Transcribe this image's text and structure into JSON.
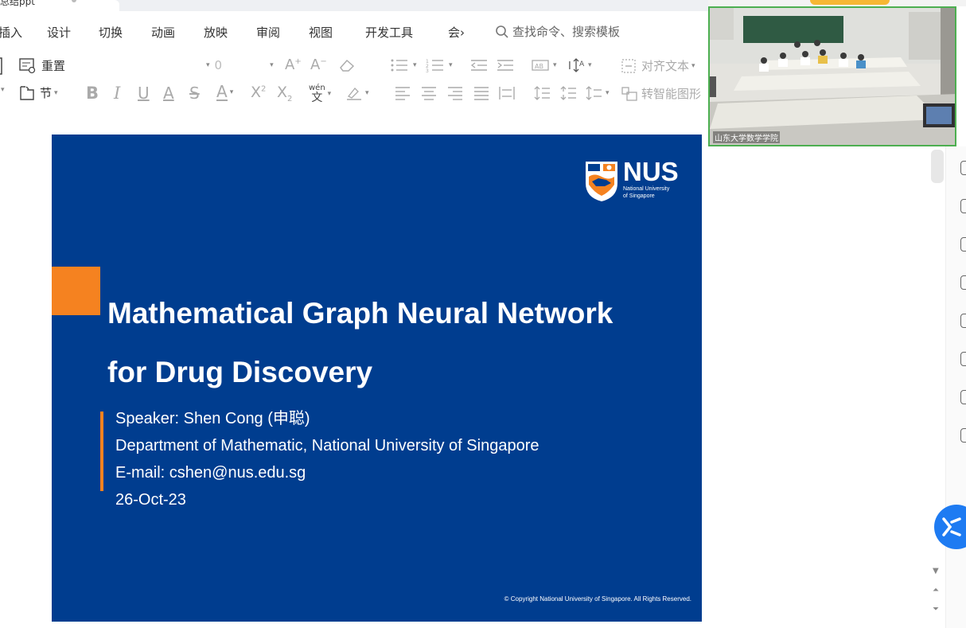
{
  "window": {
    "doc_tab_label": "总结ppt"
  },
  "menu": {
    "items": [
      "插入",
      "设计",
      "切换",
      "动画",
      "放映",
      "审阅",
      "视图",
      "开发工具",
      "会›"
    ],
    "search_placeholder": "查找命令、搜索模板"
  },
  "ribbon": {
    "reset_label": "重置",
    "section_label": "节",
    "font_size_value": "0",
    "align_text_label": "对齐文本",
    "smart_shape_label": "转智能图形",
    "pinyin_label": "wén"
  },
  "slide": {
    "title_line1": "Mathematical Graph Neural Network",
    "title_line2": "for Drug Discovery",
    "speaker": "Speaker: Shen Cong (申聪)",
    "department": "Department of Mathematic, National University of Singapore",
    "email": "E-mail: cshen@nus.edu.sg",
    "date": "26-Oct-23",
    "copyright": "© Copyright National University of Singapore. All Rights Reserved.",
    "logo_text": "NUS",
    "logo_subtext_line1": "National University",
    "logo_subtext_line2": "of Singapore",
    "colors": {
      "background": "#003d8f",
      "accent": "#f58220"
    }
  },
  "video": {
    "caption": "山东大学数学学院"
  },
  "icons": [
    "search-icon",
    "reset-icon",
    "section-icon",
    "bold-icon",
    "italic-icon",
    "underline-icon",
    "strikethrough-icon",
    "font-color-icon",
    "superscript-icon",
    "subscript-icon",
    "eraser-icon",
    "bullet-list-icon",
    "numbered-list-icon",
    "align-left-icon",
    "align-center-icon",
    "align-right-icon",
    "justify-icon",
    "line-spacing-icon",
    "highlight-icon",
    "smart-shape-icon",
    "share-icon"
  ]
}
